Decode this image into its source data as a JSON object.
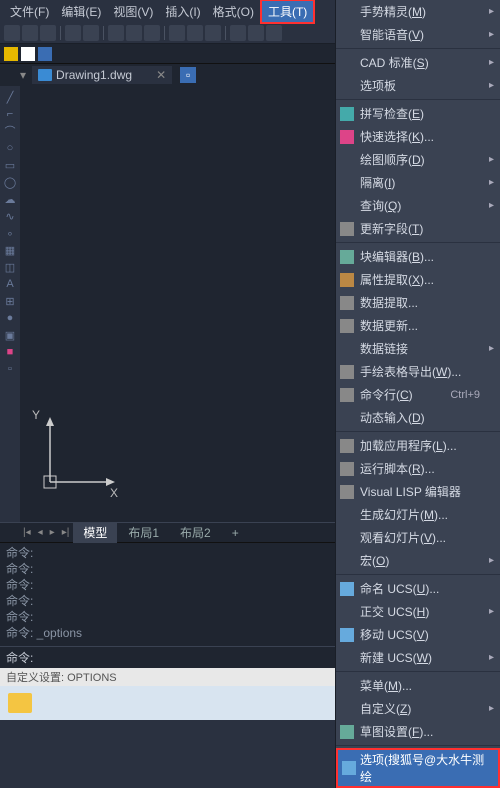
{
  "menubar": {
    "items": [
      "文件(F)",
      "编辑(E)",
      "视图(V)",
      "插入(I)",
      "格式(O)",
      "工具(T)"
    ]
  },
  "filetab": {
    "name": "Drawing1.dwg"
  },
  "axis": {
    "y": "Y",
    "x": "X"
  },
  "modeltabs": {
    "model": "模型",
    "layout1": "布局1",
    "layout2": "布局2",
    "plus": "+"
  },
  "cmdlog": [
    "命令:",
    "命令:",
    "命令:",
    "命令:",
    "命令:",
    "命令: _options"
  ],
  "cmdprompt": "命令:",
  "statusbar": "自定义设置: OPTIONS",
  "dropdown": [
    {
      "label": "手势精灵(M)",
      "type": "arrow"
    },
    {
      "label": "智能语音(V)",
      "type": "arrow"
    },
    {
      "type": "sep"
    },
    {
      "label": "CAD 标准(S)",
      "type": "arrow"
    },
    {
      "label": "选项板",
      "type": "arrow"
    },
    {
      "type": "sep"
    },
    {
      "label": "拼写检查(E)",
      "icon": "#4aa"
    },
    {
      "label": "快速选择(K)...",
      "icon": "#d48"
    },
    {
      "label": "绘图顺序(D)",
      "type": "arrow"
    },
    {
      "label": "隔离(I)",
      "type": "arrow"
    },
    {
      "label": "查询(Q)",
      "type": "arrow"
    },
    {
      "label": "更新字段(T)",
      "icon": "#888"
    },
    {
      "type": "sep"
    },
    {
      "label": "块编辑器(B)...",
      "icon": "#6a9"
    },
    {
      "label": "属性提取(X)...",
      "icon": "#b84"
    },
    {
      "label": "数据提取...",
      "icon": "#888"
    },
    {
      "label": "数据更新...",
      "icon": "#888"
    },
    {
      "label": "数据链接",
      "type": "arrow"
    },
    {
      "label": "手绘表格导出(W)...",
      "icon": "#888"
    },
    {
      "label": "命令行(C)",
      "shortcut": "Ctrl+9",
      "icon": "#888"
    },
    {
      "label": "动态输入(D)"
    },
    {
      "type": "sep"
    },
    {
      "label": "加载应用程序(L)...",
      "icon": "#888"
    },
    {
      "label": "运行脚本(R)...",
      "icon": "#888"
    },
    {
      "label": "Visual LISP 编辑器",
      "icon": "#888"
    },
    {
      "label": "生成幻灯片(M)..."
    },
    {
      "label": "观看幻灯片(V)..."
    },
    {
      "label": "宏(O)",
      "type": "arrow"
    },
    {
      "type": "sep"
    },
    {
      "label": "命名 UCS(U)...",
      "icon": "#6ad"
    },
    {
      "label": "正交 UCS(H)",
      "type": "arrow"
    },
    {
      "label": "移动 UCS(V)",
      "icon": "#6ad"
    },
    {
      "label": "新建 UCS(W)",
      "type": "arrow"
    },
    {
      "type": "sep"
    },
    {
      "label": "菜单(M)..."
    },
    {
      "label": "自定义(Z)",
      "type": "arrow"
    },
    {
      "label": "草图设置(F)...",
      "icon": "#6a9"
    },
    {
      "type": "sep"
    },
    {
      "label": "选项(搜狐号@大水牛测绘",
      "icon": "#6ad",
      "highlighted": true
    }
  ]
}
